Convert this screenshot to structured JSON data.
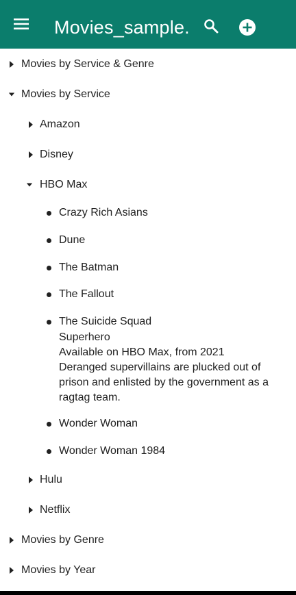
{
  "appbar": {
    "title": "Movies_sample...",
    "menu_icon": "menu-icon",
    "search_icon": "search-icon",
    "add_icon": "add-circle-icon",
    "color": "#0b7d6c"
  },
  "tree": {
    "service_genre": "Movies by Service & Genre",
    "service": "Movies by Service",
    "amazon": "Amazon",
    "disney": "Disney",
    "hbomax": "HBO Max",
    "hbo_items": [
      "Crazy Rich Asians",
      "Dune",
      "The Batman",
      "The Fallout",
      "The Suicide Squad",
      "Wonder Woman",
      "Wonder Woman 1984"
    ],
    "suicide_squad_details": {
      "genre": "Superhero",
      "availability": "Available on HBO Max, from 2021",
      "description": "Deranged supervillains are plucked out of prison and enlisted by the government as a ragtag team."
    },
    "hulu": "Hulu",
    "netflix": "Netflix",
    "genre": "Movies by Genre",
    "year": "Movies by Year"
  }
}
